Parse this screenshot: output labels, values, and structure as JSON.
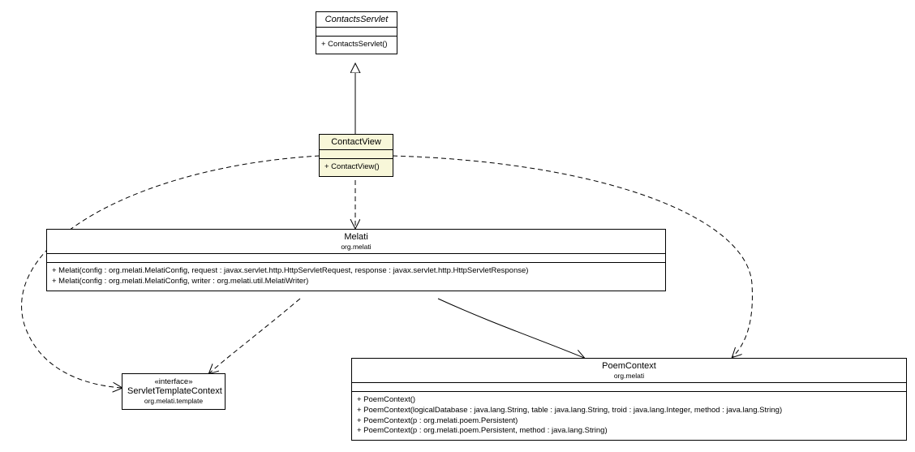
{
  "classes": {
    "contactsServlet": {
      "name": "ContactsServlet",
      "ops": [
        "+ ContactsServlet()"
      ]
    },
    "contactView": {
      "name": "ContactView",
      "ops": [
        "+ ContactView()"
      ]
    },
    "melati": {
      "name": "Melati",
      "pkg": "org.melati",
      "ops": [
        "+ Melati(config : org.melati.MelatiConfig, request : javax.servlet.http.HttpServletRequest, response : javax.servlet.http.HttpServletResponse)",
        "+ Melati(config : org.melati.MelatiConfig, writer : org.melati.util.MelatiWriter)"
      ]
    },
    "servletTemplateContext": {
      "stereotype": "«interface»",
      "name": "ServletTemplateContext",
      "pkg": "org.melati.template"
    },
    "poemContext": {
      "name": "PoemContext",
      "pkg": "org.melati",
      "ops": [
        "+ PoemContext()",
        "+ PoemContext(logicalDatabase : java.lang.String, table : java.lang.String, troid : java.lang.Integer, method : java.lang.String)",
        "+ PoemContext(p : org.melati.poem.Persistent)",
        "+ PoemContext(p : org.melati.poem.Persistent, method : java.lang.String)"
      ]
    }
  }
}
